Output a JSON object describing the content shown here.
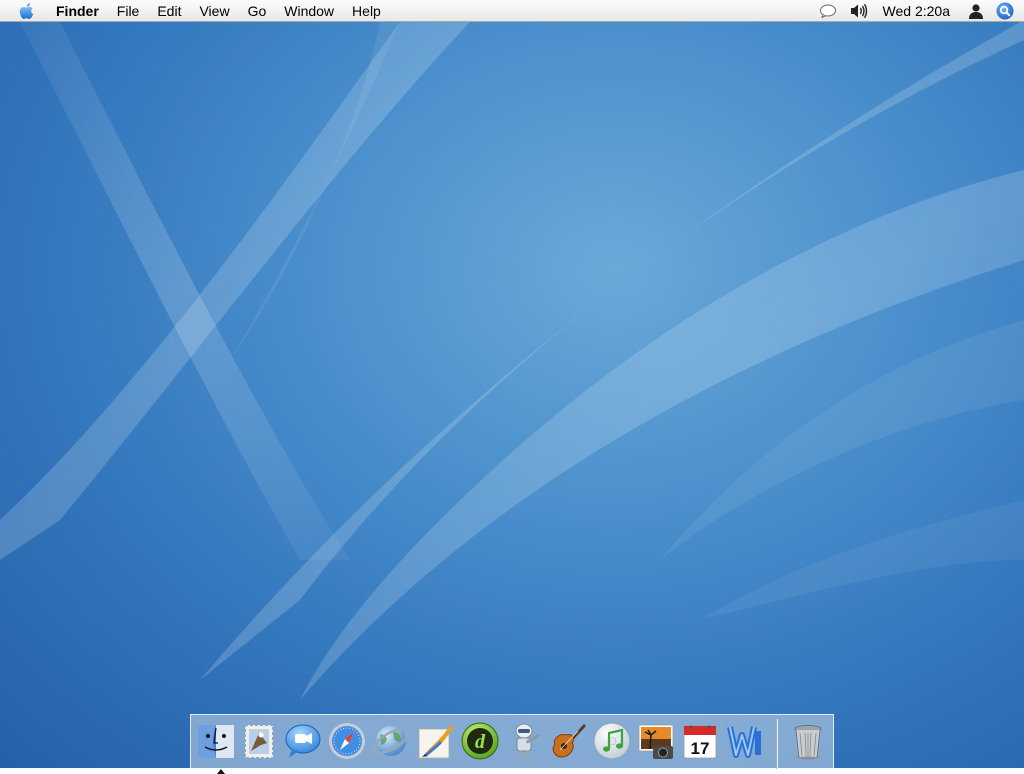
{
  "menubar": {
    "apple_icon": "apple-icon",
    "app_name": "Finder",
    "menus": [
      "File",
      "Edit",
      "View",
      "Go",
      "Window",
      "Help"
    ],
    "status": {
      "speech_icon": "speech-bubble-icon",
      "volume_icon": "volume-icon",
      "clock": "Wed 2:20a",
      "user_icon": "user-icon",
      "spotlight_icon": "spotlight-icon"
    }
  },
  "dock": {
    "items": [
      {
        "name": "finder",
        "icon": "finder-icon",
        "running": true
      },
      {
        "name": "mail",
        "icon": "mail-icon"
      },
      {
        "name": "ichat",
        "icon": "ichat-icon"
      },
      {
        "name": "safari",
        "icon": "safari-icon"
      },
      {
        "name": "internet-explorer",
        "icon": "globe-icon"
      },
      {
        "name": "painter",
        "icon": "paintbrush-icon"
      },
      {
        "name": "dreamweaver",
        "icon": "dreamweaver-icon"
      },
      {
        "name": "automator",
        "icon": "automator-icon"
      },
      {
        "name": "garageband",
        "icon": "guitar-icon"
      },
      {
        "name": "itunes",
        "icon": "itunes-icon"
      },
      {
        "name": "iphoto",
        "icon": "iphoto-icon"
      },
      {
        "name": "ical",
        "icon": "ical-icon",
        "label": "17"
      },
      {
        "name": "word",
        "icon": "word-icon"
      },
      {
        "name": "trash",
        "icon": "trash-icon"
      }
    ]
  }
}
